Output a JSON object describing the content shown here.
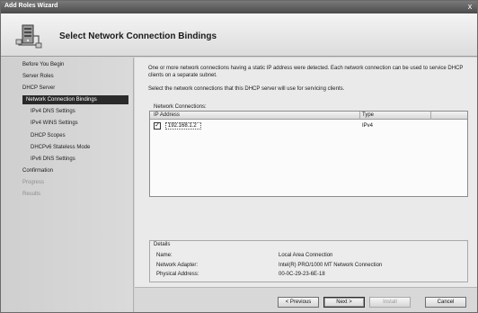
{
  "window": {
    "title": "Add Roles Wizard",
    "close_glyph": "x"
  },
  "header": {
    "title": "Select Network Connection Bindings",
    "icon": "server-network-icon"
  },
  "nav": {
    "items": [
      {
        "label": "Before You Begin",
        "state": "normal"
      },
      {
        "label": "Server Roles",
        "state": "normal"
      },
      {
        "label": "DHCP Server",
        "state": "normal"
      },
      {
        "label": "Network Connection Bindings",
        "state": "active"
      },
      {
        "label": "IPv4 DNS Settings",
        "state": "sub"
      },
      {
        "label": "IPv4 WINS Settings",
        "state": "sub"
      },
      {
        "label": "DHCP Scopes",
        "state": "sub"
      },
      {
        "label": "DHCPv6 Stateless Mode",
        "state": "sub"
      },
      {
        "label": "IPv6 DNS Settings",
        "state": "sub"
      },
      {
        "label": "Confirmation",
        "state": "normal"
      },
      {
        "label": "Progress",
        "state": "disabled"
      },
      {
        "label": "Results",
        "state": "disabled"
      }
    ]
  },
  "main": {
    "description_1": "One or more network connections having a static IP address were detected. Each network connection can be used to service DHCP clients on a separate subnet.",
    "description_2": "Select the network connections that this DHCP server will use for servicing clients.",
    "list_label": "Network Connections:",
    "columns": [
      "IP Address",
      "Type"
    ],
    "rows": [
      {
        "checked": true,
        "check_glyph": "✓",
        "ip": "192.168.1.2",
        "type": "IPv4"
      }
    ]
  },
  "details": {
    "title": "Details",
    "fields": [
      {
        "label": "Name:",
        "value": "Local Area Connection"
      },
      {
        "label": "Network Adapter:",
        "value": "Intel(R) PRO/1000 MT Network Connection"
      },
      {
        "label": "Physical Address:",
        "value": "00-0C-29-23-6E-18"
      }
    ]
  },
  "footer": {
    "previous": "< Previous",
    "next": "Next >",
    "install": "Install",
    "cancel": "Cancel"
  }
}
